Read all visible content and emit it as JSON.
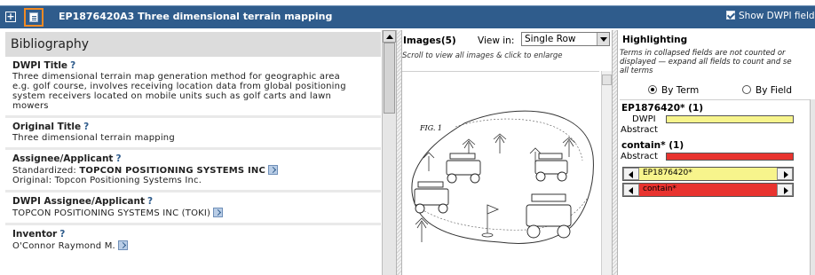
{
  "header": {
    "title": "EP1876420A3  Three dimensional terrain mapping",
    "show_dwpi_label": "Show DWPI field",
    "show_dwpi_checked": true
  },
  "bibliography": {
    "heading": "Bibliography",
    "sections": [
      {
        "label": "DWPI Title",
        "help": "?",
        "lines": [
          "Three dimensional terrain map generation method for geographic area",
          "e.g. golf course, involves receiving location data from global positioning",
          "system receivers located on mobile units such as golf carts and lawn",
          "mowers"
        ]
      },
      {
        "label": "Original Title",
        "help": "?",
        "lines": [
          "Three dimensional terrain mapping"
        ]
      },
      {
        "label": "Assignee/Applicant",
        "help": "?",
        "standardized_prefix": "Standardized: ",
        "standardized_value": "TOPCON POSITIONING SYSTEMS INC",
        "original": "Original: Topcon Positioning Systems Inc."
      },
      {
        "label": "DWPI Assignee/Applicant",
        "help": "?",
        "value": "TOPCON POSITIONING SYSTEMS INC (TOKI)"
      },
      {
        "label": "Inventor",
        "help": "?",
        "value": "O'Connor Raymond M."
      }
    ]
  },
  "images": {
    "title": "Images(5)",
    "view_in_label": "View in:",
    "view_in_value": "Single Row",
    "hint": "Scroll to view all images & click to enlarge",
    "figure_label": "FIG. 1"
  },
  "highlighting": {
    "title": "Highlighting",
    "note_lines": [
      "Terms in collapsed fields are not counted or",
      "displayed — expand all fields to count and se",
      "all terms"
    ],
    "by_term_label": "By Term",
    "by_field_label": "By Field",
    "selected_mode": "By Term",
    "terms": [
      {
        "label": "EP1876420* (1)",
        "fields": [
          "DWPI",
          "Abstract"
        ],
        "color": "#f7f48c"
      },
      {
        "label": "contain* (1)",
        "fields": [
          "Abstract"
        ],
        "color": "#e8332f"
      }
    ],
    "navigators": [
      {
        "label": "EP1876420*",
        "color": "#f7f48c"
      },
      {
        "label": "contain*",
        "color": "#e8332f"
      }
    ]
  },
  "colors": {
    "title_bar": "#2f5c8c",
    "accent_orange": "#f08a24",
    "header_gray": "#dcdcdc"
  }
}
